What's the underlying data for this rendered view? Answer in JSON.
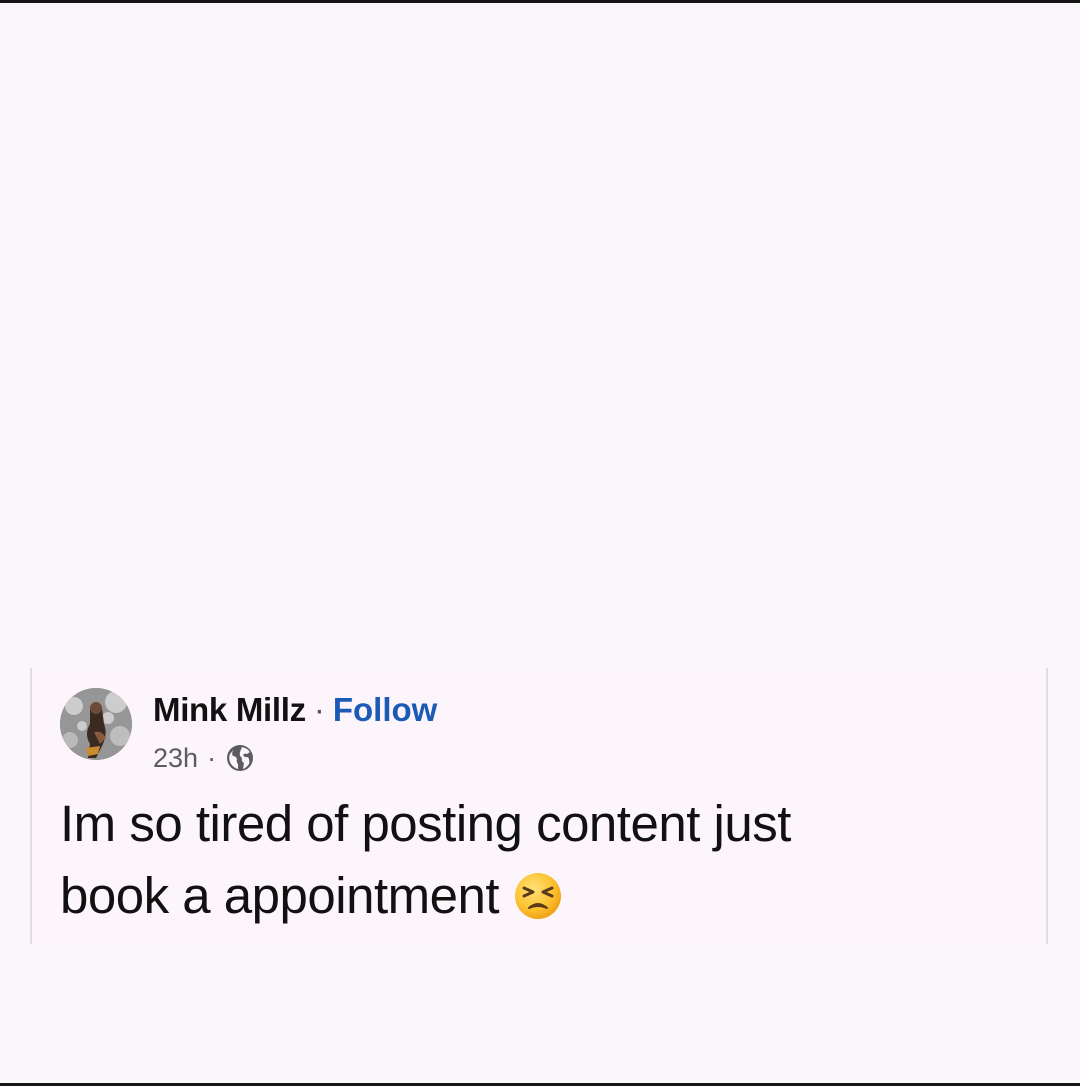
{
  "post": {
    "author": "Mink Millz",
    "separator": "·",
    "follow_label": "Follow",
    "timestamp": "23h",
    "meta_separator": "·",
    "privacy_icon": "globe-icon",
    "text_line1": "Im so tired of posting content just",
    "text_line2": "book a appointment",
    "emoji": "persevering-face-emoji"
  },
  "colors": {
    "background": "#fbf6fb",
    "link": "#1b5bb5",
    "text": "#111111",
    "meta": "#5c5c5c"
  }
}
